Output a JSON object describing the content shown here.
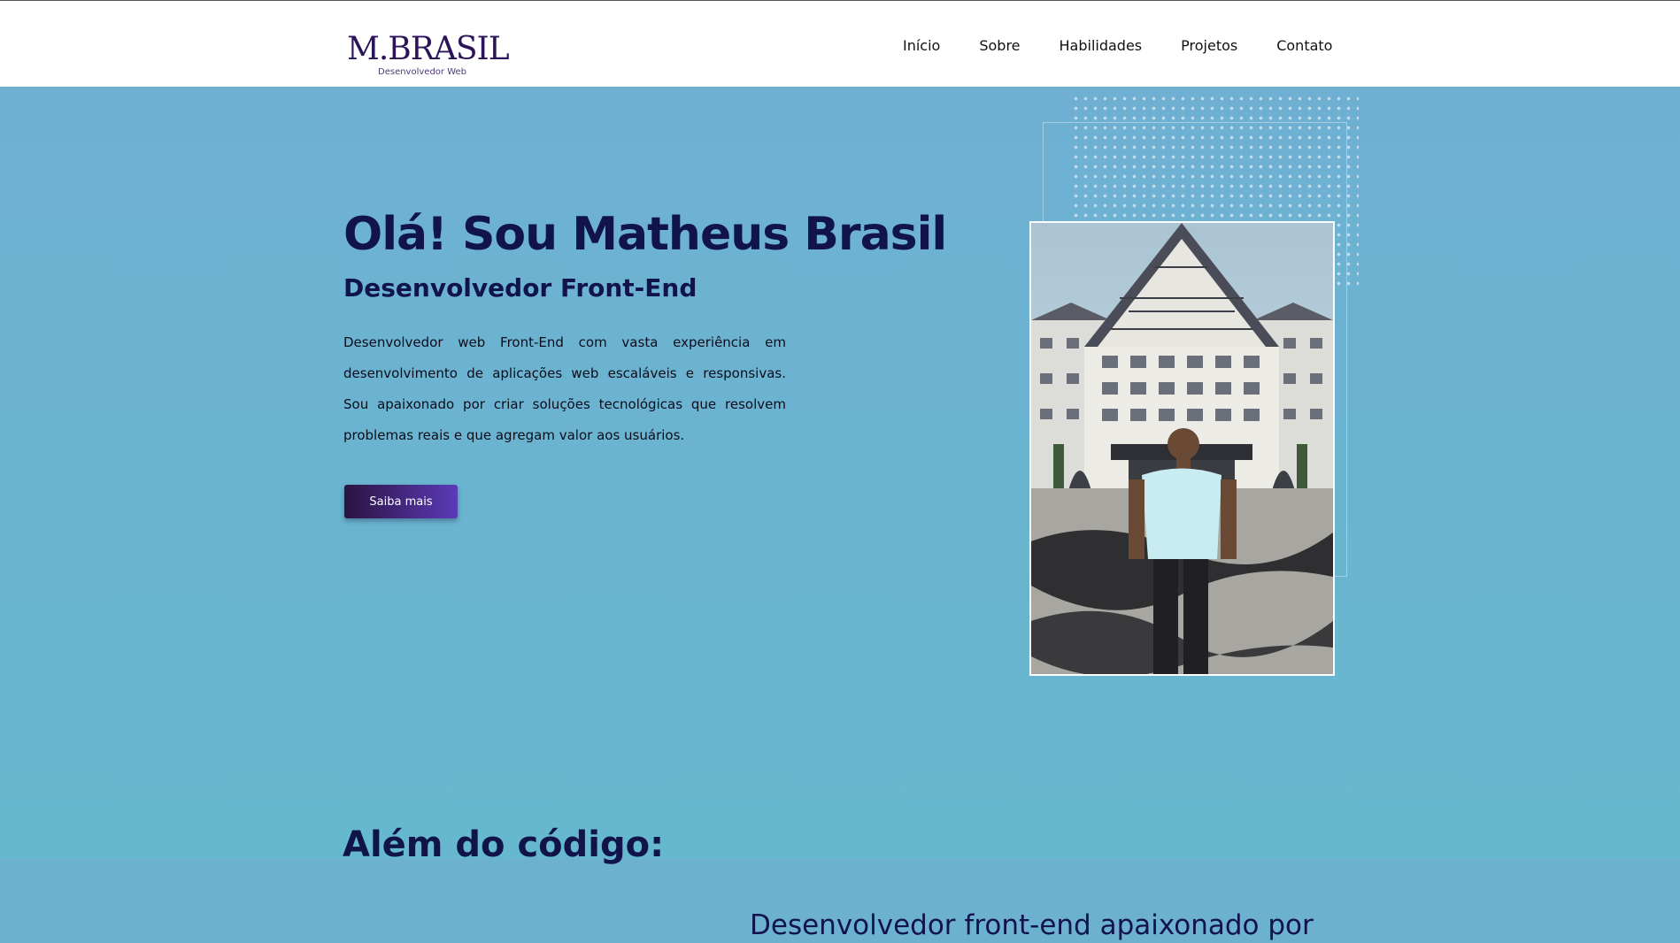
{
  "header": {
    "logo_name": "M.BRASIL",
    "logo_tagline": "Desenvolvedor Web",
    "nav": [
      "Início",
      "Sobre",
      "Habilidades",
      "Projetos",
      "Contato"
    ]
  },
  "hero": {
    "title": "Olá! Sou Matheus Brasil",
    "subtitle": "Desenvolvedor Front-End",
    "description": "Desenvolvedor web Front-End com vasta experiência em desenvolvimento de aplicações web escaláveis e responsivas. Sou apaixonado por criar soluções tecnológicas que resolvem problemas reais e que agregam valor aos usuários.",
    "cta_label": "Saiba mais"
  },
  "about": {
    "title": "Além do código:",
    "text": "Desenvolvedor front-end apaixonado por"
  },
  "colors": {
    "background": "#6db1d0",
    "heading": "#11144a",
    "logo": "#2b1457",
    "button_start": "#2a1440",
    "button_end": "#5b3ab8"
  }
}
